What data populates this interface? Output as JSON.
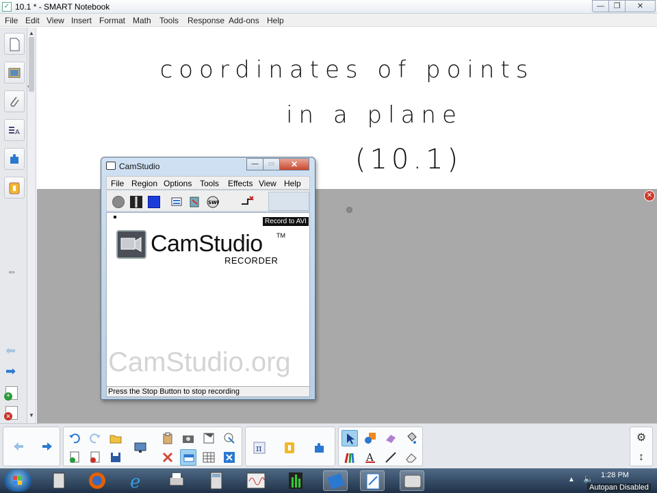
{
  "window": {
    "title": "10.1 * - SMART Notebook",
    "min_label": "—",
    "max_label": "❐",
    "close_label": "✕"
  },
  "menu": [
    "File",
    "Edit",
    "View",
    "Insert",
    "Format",
    "Math",
    "Tools",
    "Response",
    "Add-ons",
    "Help"
  ],
  "canvas": {
    "line1": "coordinates of points",
    "line2": "in a plane",
    "line3": "(10.1)"
  },
  "camstudio": {
    "title": "CamStudio",
    "menu": [
      "File",
      "Region",
      "Options",
      "Tools",
      "Effects",
      "View",
      "Help"
    ],
    "tooltip": "Record to AVI",
    "logo_name": "CamStudio",
    "logo_tm": "TM",
    "logo_sub": "RECORDER",
    "watermark": "CamStudio.org",
    "status": "Press the Stop Button to stop recording",
    "min_label": "—",
    "max_label": "▭",
    "close_label": "✕"
  },
  "taskbar": {
    "time": "1:28 PM",
    "autopan": "Autopan Disabled"
  },
  "colors": {
    "accent_blue": "#2b78d0",
    "grey_area": "#a9a9a9",
    "selected_tool": "#9fd0ef"
  }
}
